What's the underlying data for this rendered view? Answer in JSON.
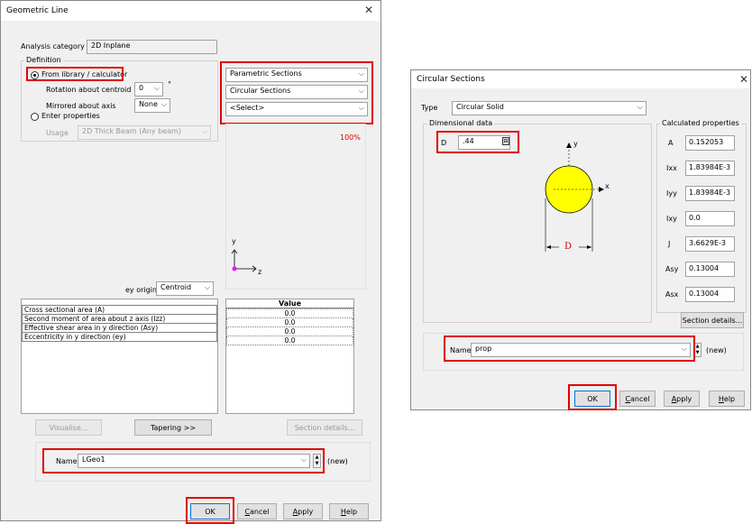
{
  "geo": {
    "title": "Geometric Line",
    "analysis_category_label": "Analysis category",
    "analysis_category_value": "2D Inplane",
    "definition_label": "Definition",
    "radio_library": "From library / calculator",
    "rotation_label": "Rotation about centroid",
    "rotation_value": "0",
    "degree": "°",
    "mirrored_label": "Mirrored about axis",
    "mirrored_value": "None",
    "radio_enter": "Enter properties",
    "usage_label": "Usage",
    "usage_value": "2D Thick Beam (Any beam)",
    "combo1": "Parametric Sections",
    "combo2": "Circular Sections",
    "combo3": "<Select>",
    "zoom": "100%",
    "axis_y": "y",
    "axis_z": "z",
    "ey_origin_label": "ey origin",
    "ey_origin_value": "Centroid",
    "value_header": "Value",
    "properties": [
      {
        "name": "Cross sectional area (A)",
        "value": "0.0"
      },
      {
        "name": "Second moment of area about z axis (Izz)",
        "value": "0.0"
      },
      {
        "name": "Effective shear area in y direction (Asy)",
        "value": "0.0"
      },
      {
        "name": "Eccentricity in y direction (ey)",
        "value": "0.0"
      }
    ],
    "visualise": "Visualise...",
    "tapering": "Tapering >>",
    "section_details": "Section details...",
    "name_label": "Name",
    "name_value": "LGeo1",
    "new_label": "(new)",
    "ok": "OK",
    "cancel_pre": "",
    "cancel_u": "C",
    "cancel_post": "ancel",
    "apply_pre": "",
    "apply_u": "A",
    "apply_post": "pply",
    "help_pre": "",
    "help_u": "H",
    "help_post": "elp"
  },
  "circ": {
    "title": "Circular Sections",
    "type_label": "Type",
    "type_value": "Circular Solid",
    "dimensional_label": "Dimensional data",
    "calc_label": "Calculated properties",
    "d_label": "D",
    "d_value": ".44",
    "diagram_y": "y",
    "diagram_x": "x",
    "diagram_d": "D",
    "calc": [
      {
        "label": "A",
        "value": "0.152053"
      },
      {
        "label": "Ixx",
        "value": "1.83984E-3"
      },
      {
        "label": "Iyy",
        "value": "1.83984E-3"
      },
      {
        "label": "Ixy",
        "value": "0.0"
      },
      {
        "label": "J",
        "value": "3.6629E-3"
      },
      {
        "label": "Asy",
        "value": "0.13004"
      },
      {
        "label": "Asx",
        "value": "0.13004"
      }
    ],
    "section_details": "Section details...",
    "name_label": "Name",
    "name_value": "prop",
    "new_label": "(new)",
    "ok": "OK",
    "cancel_u": "C",
    "cancel_post": "ancel",
    "apply_u": "A",
    "apply_post": "pply",
    "help_u": "H",
    "help_post": "elp"
  },
  "colors": {
    "highlight": "#e00000",
    "section_fill": "#ffff00",
    "centroid": "#ff00ff"
  }
}
